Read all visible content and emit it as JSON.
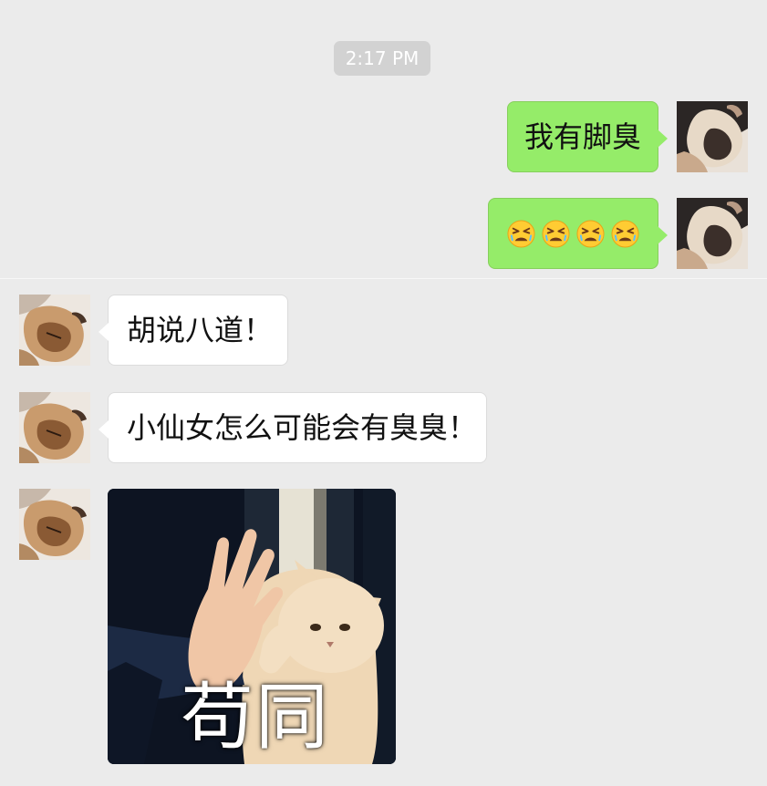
{
  "chat": {
    "timestamp": "2:17 PM",
    "colors": {
      "background": "#ebebeb",
      "sent_bubble": "#95ec69",
      "received_bubble": "#ffffff",
      "timestamp_pill": "#d2d2d2"
    },
    "messages": [
      {
        "direction": "sent",
        "type": "text",
        "text": "我有脚臭"
      },
      {
        "direction": "sent",
        "type": "emoji",
        "emoji": "😫😫😫😫"
      },
      {
        "direction": "received",
        "type": "text",
        "text": "胡说八道！"
      },
      {
        "direction": "received",
        "type": "text",
        "text": "小仙女怎么可能会有臭臭！"
      },
      {
        "direction": "received",
        "type": "sticker",
        "caption": "苟同",
        "icon": "cat-high-five-sticker"
      }
    ]
  }
}
